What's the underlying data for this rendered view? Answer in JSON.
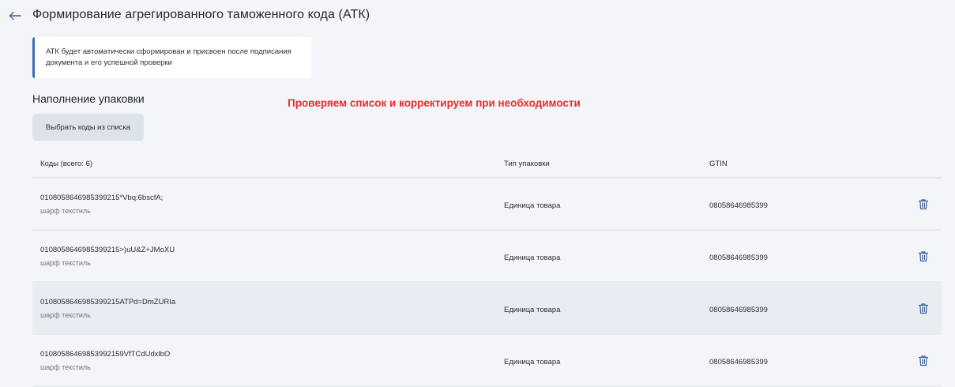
{
  "header": {
    "title": "Формирование агрегированного таможенного кода (АТК)",
    "back_icon": "arrow-left-icon"
  },
  "info": {
    "line1": "АТК будет автоматически сформирован и присвоен после подписания",
    "line2": "документа и его успешной проверки",
    "accent": "#3d6cb7"
  },
  "section": {
    "title": "Наполнение упаковки",
    "select_button": "Выбрать коды из списка"
  },
  "annotation": "Проверяем список и корректируем при необходимости",
  "table": {
    "headers": {
      "codes": "Коды (всего: 6)",
      "package_type": "Тип упаковки",
      "gtin": "GTIN"
    },
    "rows": [
      {
        "code": "0108058646985399215*Vbq:6bscfA;",
        "name": "шарф текстиль",
        "package_type": "Единица товара",
        "gtin": "08058646985399"
      },
      {
        "code": "0108058646985399215>)uU&Z+JMoXU",
        "name": "шарф текстиль",
        "package_type": "Единица товара",
        "gtin": "08058646985399"
      },
      {
        "code": "0108058646985399215ATPd=DmZURIa",
        "name": "шарф текстиль",
        "package_type": "Единица товара",
        "gtin": "08058646985399"
      },
      {
        "code": "01080586469853992159VfTCdUdxlbO",
        "name": "шарф текстиль",
        "package_type": "Единица товара",
        "gtin": "08058646985399"
      }
    ]
  },
  "colors": {
    "background": "#f4f5f8",
    "annotation": "#e8282b",
    "row_highlight": "#e8edf3",
    "icon": "#3d5f95"
  }
}
